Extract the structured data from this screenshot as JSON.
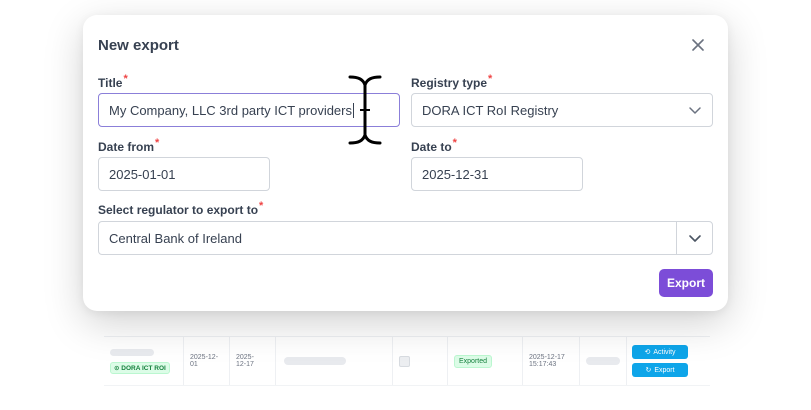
{
  "modal": {
    "title": "New export",
    "close_icon": "close-icon",
    "fields": {
      "title": {
        "label": "Title",
        "required_mark": "*",
        "value": "My Company, LLC 3rd party ICT providers"
      },
      "registry_type": {
        "label": "Registry type",
        "required_mark": "*",
        "value": "DORA ICT RoI Registry"
      },
      "date_from": {
        "label": "Date from",
        "required_mark": "*",
        "value": "2025-01-01"
      },
      "date_to": {
        "label": "Date to",
        "required_mark": "*",
        "value": "2025-12-31"
      },
      "regulator": {
        "label": "Select regulator to export to",
        "required_mark": "*",
        "value": "Central Bank of Ireland"
      }
    },
    "export_label": "Export"
  },
  "background_row": {
    "registry_badge": "DORA ICT ROI",
    "date_from_line1": "2025-12-",
    "date_from_line2": "01",
    "date_to_line1": "2025-",
    "date_to_line2": "12-17",
    "status": "Exported",
    "timestamp_line1": "2025-12-17",
    "timestamp_line2": "15:17:43",
    "activity_label": "Activity",
    "export_label": "Export"
  },
  "colors": {
    "accent": "#7c4dd8",
    "focus_border": "#8b7fd9",
    "required": "#ef4444",
    "row_button": "#0ea5e9",
    "status_green": "#15803d"
  }
}
